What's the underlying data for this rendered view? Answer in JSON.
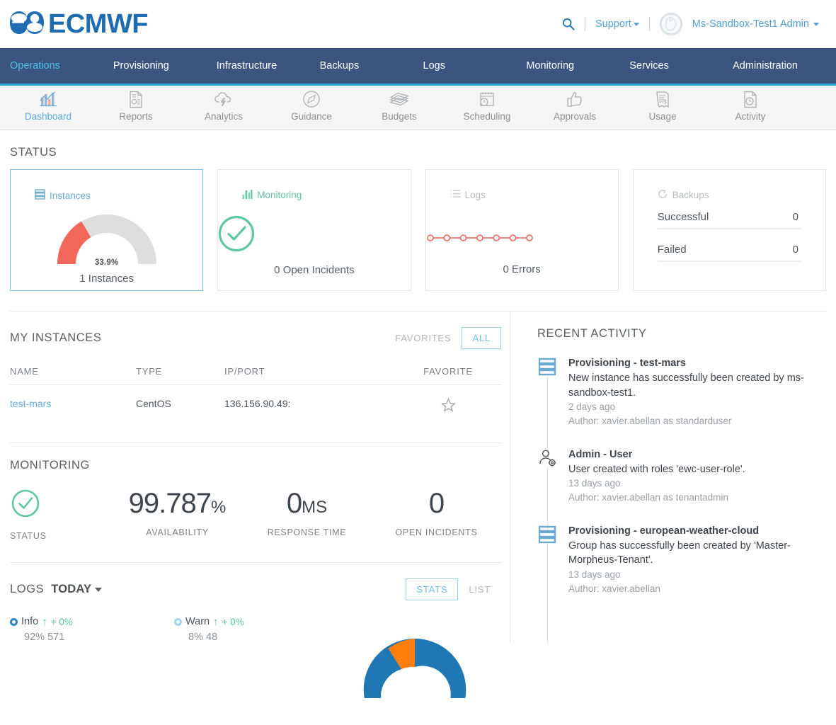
{
  "brand": {
    "logo_text": "ECMWF",
    "logo_color": "#1f6cb0"
  },
  "header": {
    "search_icon": "search-icon",
    "support_label": "Support",
    "user_label": "Ms-Sandbox-Test1 Admin",
    "avatar_icon": "user-avatar-icon"
  },
  "mainnav": {
    "items": [
      {
        "label": "Operations",
        "active": true
      },
      {
        "label": "Provisioning",
        "active": false
      },
      {
        "label": "Infrastructure",
        "active": false
      },
      {
        "label": "Backups",
        "active": false
      },
      {
        "label": "Logs",
        "active": false
      },
      {
        "label": "Monitoring",
        "active": false
      },
      {
        "label": "Services",
        "active": false
      },
      {
        "label": "Administration",
        "active": false
      }
    ],
    "bg_color": "#3c5480",
    "active_color": "#4bc3ea"
  },
  "subnav": {
    "accent_color": "#2ca8db",
    "items": [
      {
        "label": "Dashboard",
        "icon": "bar-chart-icon",
        "active": true
      },
      {
        "label": "Reports",
        "icon": "document-report-icon",
        "active": false
      },
      {
        "label": "Analytics",
        "icon": "cloud-bolt-icon",
        "active": false
      },
      {
        "label": "Guidance",
        "icon": "compass-icon",
        "active": false
      },
      {
        "label": "Budgets",
        "icon": "money-stack-icon",
        "active": false
      },
      {
        "label": "Scheduling",
        "icon": "calendar-clock-icon",
        "active": false
      },
      {
        "label": "Approvals",
        "icon": "thumbs-up-icon",
        "active": false
      },
      {
        "label": "Usage",
        "icon": "receipt-icon",
        "active": false
      },
      {
        "label": "Activity",
        "icon": "document-clock-icon",
        "active": false
      }
    ]
  },
  "status": {
    "heading": "STATUS",
    "instances": {
      "title": "Instances",
      "icon": "server-stack-icon",
      "gauge_percent_label": "33.9%",
      "gauge_percent": 33.9,
      "footer": "1 Instances",
      "arc_color": "#f2675a",
      "track_color": "#dededc"
    },
    "monitoring": {
      "title": "Monitoring",
      "icon": "bar-chart-icon",
      "footer": "0 Open Incidents",
      "color": "#5ec7a4"
    },
    "logs": {
      "title": "Logs",
      "icon": "list-icon",
      "footer": "0 Errors",
      "spark_color": "#f2675a",
      "spark_points": [
        0,
        0,
        0,
        0,
        0,
        0,
        0
      ]
    },
    "backups": {
      "title": "Backups",
      "icon": "refresh-icon",
      "rows": [
        {
          "label": "Successful",
          "value": "0"
        },
        {
          "label": "Failed",
          "value": "0"
        }
      ]
    }
  },
  "my_instances": {
    "heading": "MY INSTANCES",
    "toggle": {
      "favorites_label": "FAVORITES",
      "all_label": "ALL",
      "selected": "ALL"
    },
    "columns": [
      "NAME",
      "TYPE",
      "IP/PORT",
      "FAVORITE"
    ],
    "rows": [
      {
        "name": "test-mars",
        "type": "CentOS",
        "ip_port": "136.156.90.49:",
        "favorite": false
      }
    ]
  },
  "monitoring": {
    "heading": "MONITORING",
    "status_label": "STATUS",
    "status_icon": "check-circle-icon",
    "status_color": "#5ec7a4",
    "metrics": [
      {
        "value": "99.787",
        "unit": "%",
        "label": "AVAILABILITY"
      },
      {
        "value": "0",
        "unit": "MS",
        "label": "RESPONSE TIME"
      },
      {
        "value": "0",
        "unit": "",
        "label": "OPEN INCIDENTS"
      }
    ]
  },
  "logs": {
    "heading": "LOGS",
    "period": "TODAY",
    "toggle": {
      "stats_label": "STATS",
      "list_label": "LIST",
      "selected": "STATS"
    },
    "legend": [
      {
        "name": "Info",
        "delta": "+ 0%",
        "percent": "92%",
        "count": "571",
        "dot_color": "#2e86c1"
      },
      {
        "name": "Warn",
        "delta": "+ 0%",
        "percent": "8%",
        "count": "48",
        "dot_color": "#9fd5ee"
      }
    ],
    "chart_data": {
      "type": "pie",
      "title": "",
      "categories": [
        "Info",
        "Warn"
      ],
      "values": [
        92,
        8
      ],
      "counts": [
        571,
        48
      ],
      "colors": [
        "#1f77b4",
        "#ff7f0e"
      ],
      "legend_position": "left",
      "donut": true
    }
  },
  "recent_activity": {
    "heading": "RECENT ACTIVITY",
    "items": [
      {
        "icon": "server-stack-icon",
        "title": "Provisioning - test-mars",
        "description": "New instance has successfully been created by ms-sandbox-test1.",
        "time": "2 days ago",
        "author": "Author: xavier.abellan as standarduser"
      },
      {
        "icon": "user-gear-icon",
        "title": "Admin - User",
        "description": "User created with roles 'ewc-user-role'.",
        "time": "13 days ago",
        "author": "Author: xavier.abellan as tenantadmin"
      },
      {
        "icon": "server-stack-icon",
        "title": "Provisioning - european-weather-cloud",
        "description": "Group has successfully been created by 'Master-Morpheus-Tenant'.",
        "time": "13 days ago",
        "author": "Author: xavier.abellan"
      }
    ]
  }
}
